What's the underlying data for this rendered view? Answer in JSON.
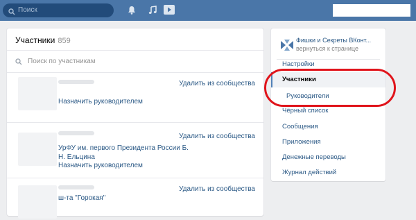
{
  "header": {
    "search_placeholder": "Поиск",
    "icons": [
      "bell-icon",
      "music-icon",
      "video-play-icon"
    ]
  },
  "members": {
    "title": "Участники",
    "count": "859",
    "search_placeholder": "Поиск по участникам",
    "items": [
      {
        "name": "",
        "assign_label": "Назначить руководителем",
        "remove_label": "Удалить из сообщества"
      },
      {
        "name": "УрФУ им. первого Президента России Б. Н. Ельцина",
        "assign_label": "Назначить руководителем",
        "remove_label": "Удалить из сообщества"
      },
      {
        "name": "ш-та \"Горокая\"",
        "assign_label": "",
        "remove_label": "Удалить из сообщества"
      }
    ]
  },
  "sidebar": {
    "group_title": "Фишки и Секреты ВКонт...",
    "group_back": "вернуться к странице",
    "items": [
      {
        "label": "Настройки"
      },
      {
        "label": "Участники"
      },
      {
        "label": "Руководители"
      },
      {
        "label": "Чёрный список"
      },
      {
        "label": "Сообщения"
      },
      {
        "label": "Приложения"
      },
      {
        "label": "Денежные переводы"
      },
      {
        "label": "Журнал действий"
      }
    ]
  },
  "colors": {
    "header_bg": "#4a76a8",
    "link": "#2a5885",
    "annotation": "#e0141b"
  }
}
